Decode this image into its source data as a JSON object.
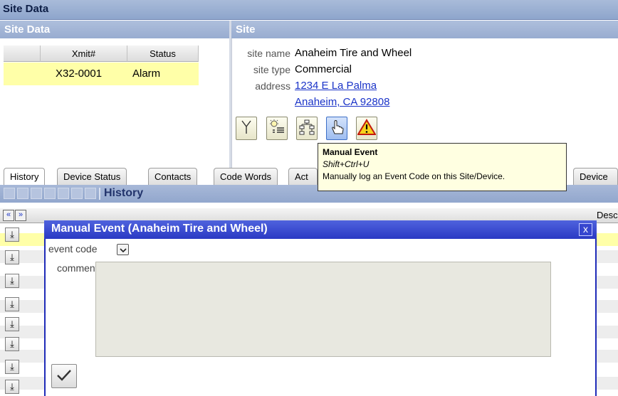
{
  "window": {
    "title": "Site Data"
  },
  "left_panel": {
    "header": "Site Data",
    "columns": [
      "Xmit#",
      "Status"
    ],
    "rows": [
      {
        "xmit": "X32-0001",
        "status": "Alarm"
      }
    ]
  },
  "site": {
    "header": "Site",
    "name_label": "site name",
    "name": "Anaheim Tire and Wheel",
    "type_label": "site type",
    "type": "Commercial",
    "address_label": "address",
    "address_line1": "1234 E La Palma",
    "address_line2": "Anaheim, CA 92808",
    "toolbar": [
      "antenna-icon",
      "lamp-list-icon",
      "org-chart-icon",
      "hand-pointer-icon",
      "warning-icon"
    ]
  },
  "tooltip": {
    "title": "Manual Event",
    "shortcut": "Shift+Ctrl+U",
    "description": "Manually log an Event Code on this Site/Device."
  },
  "tabs": [
    "History",
    "Device Status",
    "Contacts",
    "Code Words",
    "Act",
    "Device"
  ],
  "history_toolbar": {
    "label": "History"
  },
  "grid": {
    "nav_prev": "«",
    "nav_next": "»",
    "partial_header": "Desc"
  },
  "dialog": {
    "title": "Manual Event (Anaheim Tire and Wheel)",
    "close": "x",
    "event_code_label": "event code",
    "comment_label": "comment",
    "comment_value": ""
  },
  "colors": {
    "titlebar": "#a9bbd9",
    "selected_row": "#ffffa8",
    "dialog_title": "#2a39c4",
    "link": "#1a33c8",
    "tooltip_bg": "#ffffe1"
  }
}
